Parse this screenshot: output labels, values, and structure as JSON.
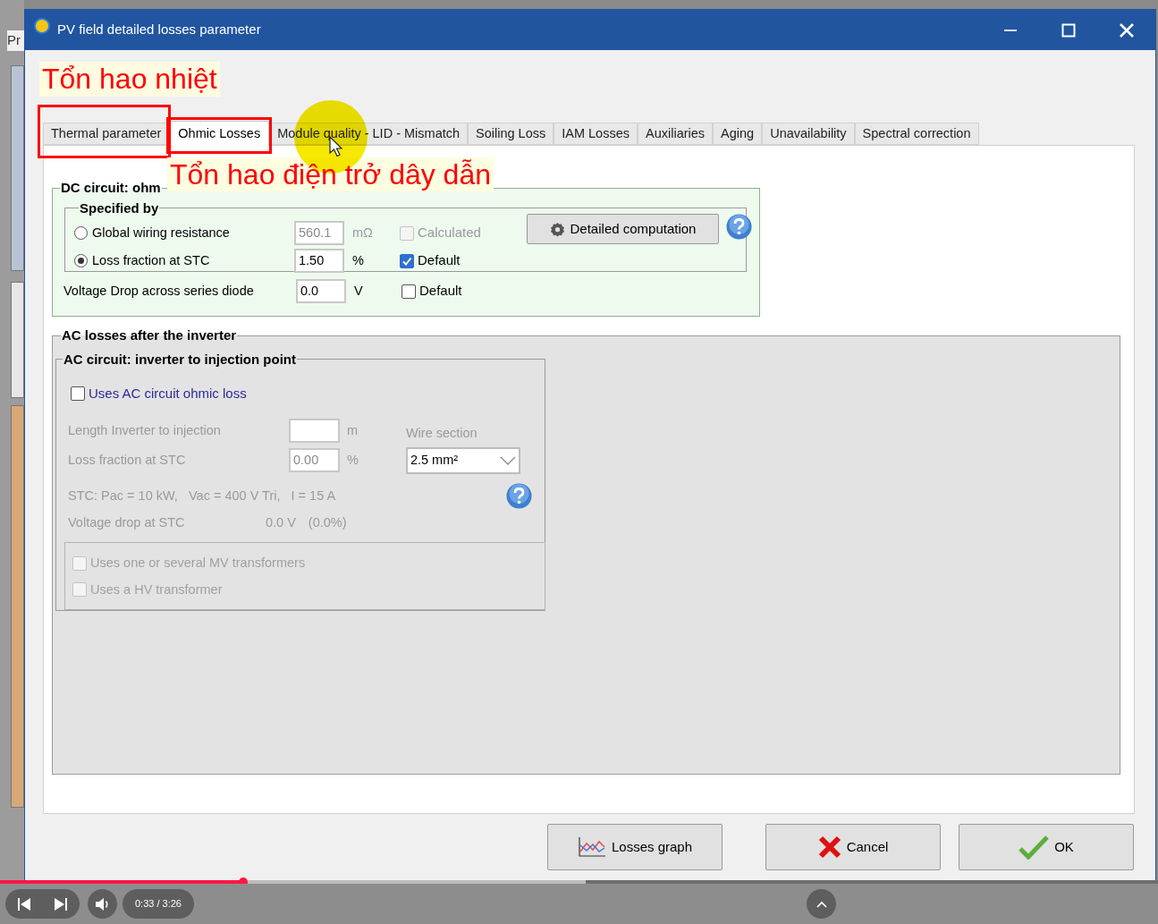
{
  "background_app": {
    "title_fragment": "Pr"
  },
  "window": {
    "title": "PV field detailed losses parameter"
  },
  "annotations": [
    {
      "text": "Tổn hao nhiệt"
    },
    {
      "text": "Tổn hao điện trở dây dẫn"
    }
  ],
  "tabs": [
    {
      "label": "Thermal parameter",
      "selected": false,
      "highlighted": true
    },
    {
      "label": "Ohmic Losses",
      "selected": true,
      "highlighted": true
    },
    {
      "label": "Module quality - LID - Mismatch",
      "selected": false,
      "highlighted": false
    },
    {
      "label": "Soiling Loss",
      "selected": false,
      "highlighted": false
    },
    {
      "label": "IAM Losses",
      "selected": false,
      "highlighted": false
    },
    {
      "label": "Auxiliaries",
      "selected": false,
      "highlighted": false
    },
    {
      "label": "Aging",
      "selected": false,
      "highlighted": false
    },
    {
      "label": "Unavailability",
      "selected": false,
      "highlighted": false
    },
    {
      "label": "Spectral correction",
      "selected": false,
      "highlighted": false
    }
  ],
  "dc_circuit": {
    "title": "DC circuit: ohm",
    "specified_by": "Specified by",
    "options": [
      {
        "label": "Global wiring resistance",
        "selected": false,
        "value": "560.1",
        "unit": "mΩ",
        "disabled": true,
        "check": {
          "label": "Calculated",
          "checked": false,
          "disabled": true
        }
      },
      {
        "label": "Loss fraction at STC",
        "selected": true,
        "value": "1.50",
        "unit": "%",
        "disabled": false,
        "check": {
          "label": "Default",
          "checked": true,
          "disabled": false
        }
      }
    ],
    "button": "Detailed computation",
    "diode": {
      "label": "Voltage Drop across series diode",
      "value": "0.0",
      "unit": "V",
      "check": {
        "label": "Default",
        "checked": false,
        "disabled": false
      }
    }
  },
  "ac_losses": {
    "title": "AC losses after the inverter",
    "circuit": {
      "title": "AC circuit: inverter to injection point",
      "uses_check": {
        "label": "Uses AC circuit ohmic loss",
        "checked": false
      },
      "fields": [
        {
          "label": "Length Inverter to injection",
          "unit": "m"
        },
        {
          "label": "Loss fraction at STC",
          "value": "0.00",
          "unit": "%"
        }
      ],
      "wire_section": {
        "label": "Wire section",
        "value": "2.5 mm²"
      },
      "stc_line": "STC: Pac = 10 kW,   Vac = 400 V Tri,   I = 15 A",
      "voltage_drop": {
        "label": "Voltage drop at STC",
        "value": "0.0 V",
        "percent": "(0.0%)"
      }
    },
    "transformers": [
      {
        "label": "Uses one or several MV transformers",
        "checked": false,
        "disabled": true
      },
      {
        "label": "Uses a HV transformer",
        "checked": false,
        "disabled": true
      }
    ]
  },
  "buttons": [
    {
      "label": "Losses graph",
      "kind": "graph"
    },
    {
      "label": "Cancel",
      "kind": "cancel"
    },
    {
      "label": "OK",
      "kind": "ok"
    }
  ],
  "player": {
    "time": "0:33 / 3:26",
    "level": 0.21
  }
}
